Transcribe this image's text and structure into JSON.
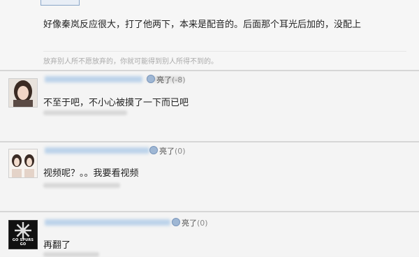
{
  "posts": [
    {
      "content": "好像秦岚反应很大，打了他两下，本来是配音的。后面那个耳光后加的，没配上",
      "signature": "放弃别人所不愿放弃的，你就可能得到别人所得不到的。"
    },
    {
      "like_label": "亮了",
      "like_count": "(-8)",
      "content": "不至于吧，不小心被摸了一下而已吧"
    },
    {
      "like_label": "亮了",
      "like_count": "(0)",
      "content": "视频呢？。。我要看视频"
    },
    {
      "like_label": "亮了",
      "like_count": "(0)",
      "content": "再翻了",
      "avatar_text": "GO SPURS GO"
    }
  ],
  "colors": {
    "accent": "#9fb7d4",
    "background": "#f3f3f3"
  },
  "icons": [
    "heart-like-icon"
  ]
}
